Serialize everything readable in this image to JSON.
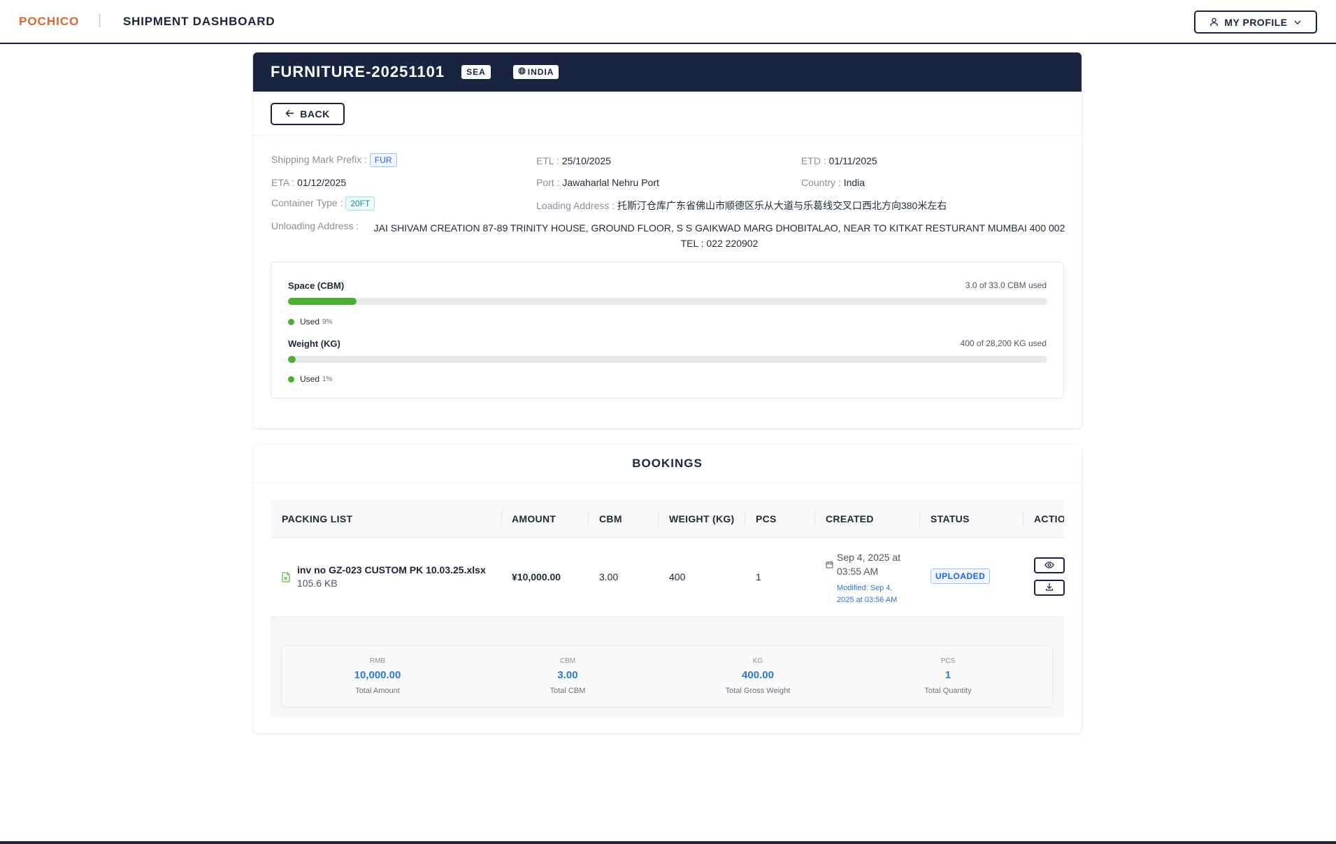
{
  "nav": {
    "brand": "POCHICO",
    "separator": "|",
    "title": "SHIPMENT DASHBOARD",
    "profile_label": "MY PROFILE"
  },
  "shipment": {
    "title": "FURNITURE-20251101",
    "mode_tag": "SEA",
    "country_tag": "INDIA",
    "back_label": "BACK",
    "fields": {
      "shipping_mark_label": "Shipping Mark Prefix :",
      "shipping_mark_value": "FUR",
      "etl_label": "ETL :",
      "etl_value": "25/10/2025",
      "etd_label": "ETD :",
      "etd_value": "01/11/2025",
      "eta_label": "ETA :",
      "eta_value": "01/12/2025",
      "port_label": "Port :",
      "port_value": "Jawaharlal Nehru Port",
      "country_label": "Country :",
      "country_value": "India",
      "container_label": "Container Type :",
      "container_value": "20FT",
      "loading_label": "Loading Address :",
      "loading_value": "托斯汀仓库广东省佛山市顺德区乐从大道与乐葛线交叉口西北方向380米左右",
      "unloading_label": "Unloading Address :",
      "unloading_line1": "JAI SHIVAM CREATION 87-89 TRINITY HOUSE, GROUND FLOOR, S S GAIKWAD MARG DHOBITALAO, NEAR TO KITKAT RESTURANT MUMBAI 400 002",
      "unloading_line2": "TEL : 022 220902"
    },
    "usage": {
      "space": {
        "title": "Space (CBM)",
        "summary": "3.0 of 33.0 CBM used",
        "legend": "Used",
        "percent_label": "9%",
        "fraction": 0.09
      },
      "weight": {
        "title": "Weight (KG)",
        "summary": "400 of 28,200 KG used",
        "legend": "Used",
        "percent_label": "1%",
        "fraction": 0.01
      },
      "accent_color": "#4cae30"
    }
  },
  "bookings": {
    "title": "BOOKINGS",
    "columns": [
      "PACKING LIST",
      "AMOUNT",
      "CBM",
      "WEIGHT (KG)",
      "PCS",
      "CREATED",
      "STATUS",
      "ACTIO"
    ],
    "rows": [
      {
        "file_name": "inv no GZ-023 CUSTOM PK 10.03.25.xlsx",
        "file_size": "105.6 KB",
        "amount": "¥10,000.00",
        "cbm": "3.00",
        "weight": "400",
        "pcs": "1",
        "created_line1": "Sep 4, 2025 at",
        "created_line2": "03:55 AM",
        "modified_line1": "Modified: Sep 4,",
        "modified_line2": "2025 at 03:56 AM",
        "status": "UPLOADED"
      }
    ],
    "totals": [
      {
        "unit": "RMB",
        "value": "10,000.00",
        "label": "Total Amount"
      },
      {
        "unit": "CBM",
        "value": "3.00",
        "label": "Total CBM"
      },
      {
        "unit": "KG",
        "value": "400.00",
        "label": "Total Gross Weight"
      },
      {
        "unit": "PCS",
        "value": "1",
        "label": "Total Quantity"
      }
    ]
  },
  "colors": {
    "navy": "#1a2340",
    "brand": "#e8632c",
    "link_blue": "#2a78d4"
  },
  "icons": [
    "user-icon",
    "chevron-down-icon",
    "globe-icon",
    "arrow-left-icon",
    "excel-file-icon",
    "calendar-icon",
    "eye-icon",
    "download-icon"
  ]
}
